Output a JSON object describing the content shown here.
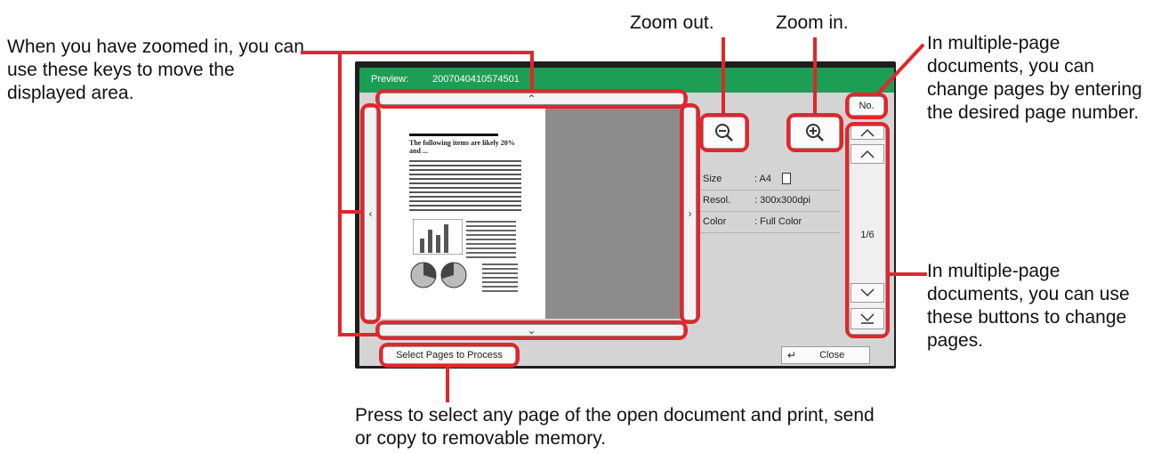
{
  "colors": {
    "accent": "#e2262b",
    "titlebar": "#1d9e55"
  },
  "preview": {
    "title_label": "Preview:",
    "doc_id": "2007040410574501",
    "no_label": "No.",
    "info": [
      {
        "key": "Size",
        "value": ": A4"
      },
      {
        "key": "Resol.",
        "value": ": 300x300dpi"
      },
      {
        "key": "Color",
        "value": ": Full Color"
      }
    ],
    "page_indicator": "1/6",
    "select_pages_label": "Select Pages to Process",
    "close_label": "Close",
    "thumb_heading": "The following items are likely 20% and ...",
    "icons": [
      "zoom-out-icon",
      "zoom-in-icon",
      "scroll-up-icon",
      "scroll-down-icon",
      "scroll-left-icon",
      "scroll-right-icon",
      "first-page-icon",
      "prev-page-icon",
      "next-page-icon",
      "last-page-icon",
      "portrait-page-icon",
      "enter-icon"
    ]
  },
  "callouts": {
    "move_area": "When you have zoomed in, you can use these keys to move the displayed area.",
    "zoom_out": "Zoom out.",
    "zoom_in": "Zoom in.",
    "page_number": "In multiple-page documents, you can change pages by entering the desired page number.",
    "page_buttons": "In multiple-page documents, you can use these buttons to change pages.",
    "select_pages": "Press to select any page of the open document and print, send or copy to removable memory."
  }
}
